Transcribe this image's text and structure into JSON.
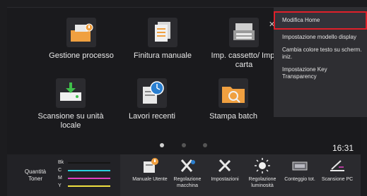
{
  "home": {
    "apps": [
      {
        "label": "Gestione processo",
        "icon": "job-management-icon"
      },
      {
        "label": "Finitura manuale",
        "icon": "manual-finishing-icon"
      },
      {
        "label": "Imp. cassetto/ Imp. carta",
        "icon": "tray-paper-settings-icon"
      },
      {
        "label": "Scansione su unità locale",
        "icon": "scan-to-local-drive-icon"
      },
      {
        "label": "Lavori recenti",
        "icon": "recent-jobs-icon"
      },
      {
        "label": "Stampa batch",
        "icon": "batch-print-icon"
      }
    ],
    "page_dots": 3,
    "active_dot": 0,
    "clock": "16:31"
  },
  "side_menu": {
    "items": [
      {
        "label": "Modifica Home",
        "active": true
      },
      {
        "label": "Impostazione modello display",
        "active": false
      },
      {
        "label": "Cambia colore testo su scherm. iniz.",
        "active": false
      },
      {
        "label": "Impostazione Key Transparency",
        "active": false
      }
    ]
  },
  "taskbar": {
    "toner": {
      "label": "Quantità Toner",
      "channels": [
        {
          "name": "Bk",
          "color": "#141414"
        },
        {
          "name": "C",
          "color": "#2ad0e0"
        },
        {
          "name": "M",
          "color": "#e040c0"
        },
        {
          "name": "Y",
          "color": "#f0e040"
        }
      ]
    },
    "buttons": [
      {
        "label": "Manuale Utente",
        "icon": "user-manual-icon"
      },
      {
        "label": "Regolazione macchina",
        "icon": "machine-adjustment-icon"
      },
      {
        "label": "Impostazioni",
        "icon": "settings-tools-icon"
      },
      {
        "label": "Regolazione luminosità",
        "icon": "brightness-icon"
      },
      {
        "label": "Conteggio tot.",
        "icon": "total-count-icon"
      },
      {
        "label": "Scansione PC",
        "icon": "pc-scan-icon"
      }
    ]
  },
  "colors": {
    "accent_red": "#e0202a",
    "folder_orange": "#f0a040",
    "background": "#1c1c1f"
  }
}
